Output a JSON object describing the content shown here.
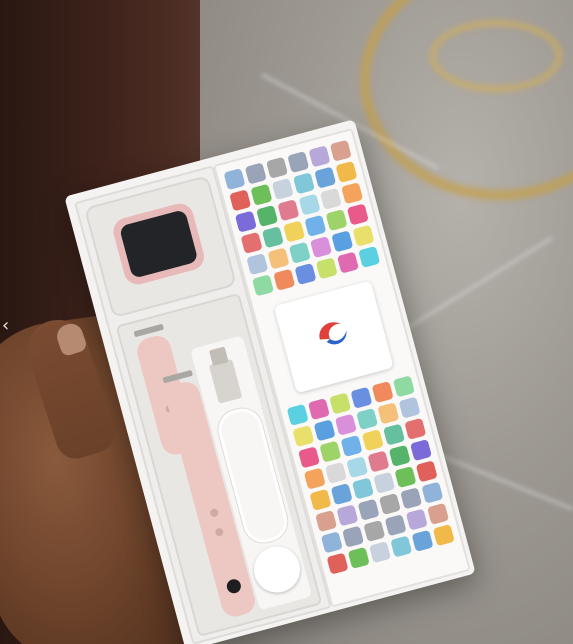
{
  "scene": {
    "subject": "smartwatch-box",
    "colors": {
      "box": "#f4f3f1",
      "strap": "#edc8c3",
      "watch_case": "#e8b9b9",
      "watch_screen": "#232427",
      "background_wood": "#3b211a",
      "background_floor": "#9d9892",
      "gold_accent": "#c4a04e"
    },
    "icons": [
      "app-icon-grid",
      "brand-logo-icon",
      "usb-cable-icon",
      "charger-icon",
      "chevron-left-icon"
    ],
    "app_tile_colors": [
      "#8fb3d9",
      "#9aa4b8",
      "#a7a7a7",
      "#9aa4b8",
      "#b8a7d9",
      "#d99f8f",
      "#e0605a",
      "#6dbf5a",
      "#c8d2de",
      "#7fc7d9",
      "#6aa3d9",
      "#f1b84a",
      "#7a6bd9",
      "#55b36a",
      "#e07a8f",
      "#a6d8e8",
      "#d9d9d9",
      "#f3a35b",
      "#e36f6f",
      "#66c0a0",
      "#f0d25a",
      "#6fb1e8",
      "#9ed36a",
      "#e85a8a",
      "#b0c4de",
      "#f5c07a",
      "#7fd1c7",
      "#d98fd9",
      "#5aa0e0",
      "#e8e06a",
      "#8fd9a3",
      "#f08a5d",
      "#6a8fe0",
      "#c7e06a",
      "#e06ab0",
      "#5ad0e0"
    ]
  }
}
